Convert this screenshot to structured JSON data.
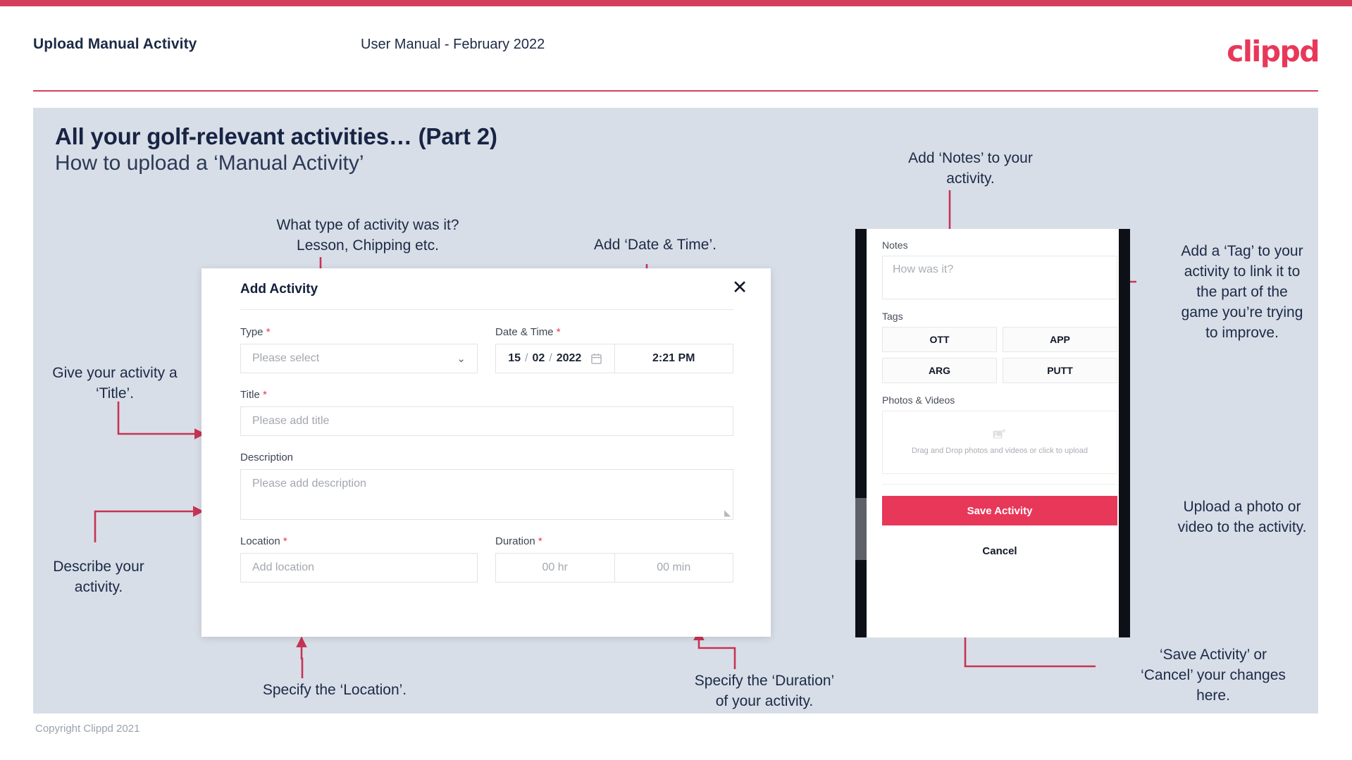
{
  "header": {
    "title": "Upload Manual Activity",
    "subtitle": "User Manual - February 2022",
    "logo": "clippd"
  },
  "slide": {
    "title": "All your golf-relevant activities… (Part 2)",
    "subtitle": "How to upload a ‘Manual Activity’",
    "copyright": "Copyright Clippd 2021"
  },
  "annotations": {
    "type": "What type of activity was it?\nLesson, Chipping etc.",
    "datetime": "Add ‘Date & Time’.",
    "title": "Give your activity a\n‘Title’.",
    "description": "Describe your\nactivity.",
    "location": "Specify the ‘Location’.",
    "duration": "Specify the ‘Duration’\nof your activity.",
    "notes": "Add ‘Notes’ to your\nactivity.",
    "tags": "Add a ‘Tag’ to your\nactivity to link it to\nthe part of the\ngame you’re trying\nto improve.",
    "upload": "Upload a photo or\nvideo to the activity.",
    "save": "‘Save Activity’ or\n‘Cancel’ your changes\nhere."
  },
  "modal": {
    "title": "Add Activity",
    "close_icon": "close-icon",
    "fields": {
      "type": {
        "label": "Type",
        "required": "*",
        "placeholder": "Please select",
        "chevron_icon": "chevron-down-icon"
      },
      "datetime": {
        "label": "Date & Time",
        "required": "*",
        "day": "15",
        "month": "02",
        "year": "2022",
        "sep": "/",
        "calendar_icon": "calendar-icon",
        "time": "2:21 PM"
      },
      "title": {
        "label": "Title",
        "required": "*",
        "placeholder": "Please add title"
      },
      "description": {
        "label": "Description",
        "required": "",
        "placeholder": "Please add description"
      },
      "location": {
        "label": "Location",
        "required": "*",
        "placeholder": "Add location"
      },
      "duration": {
        "label": "Duration",
        "required": "*",
        "hours_placeholder": "00 hr",
        "minutes_placeholder": "00 min"
      }
    }
  },
  "phone": {
    "notes": {
      "label": "Notes",
      "placeholder": "How was it?"
    },
    "tags": {
      "label": "Tags",
      "options": [
        "OTT",
        "APP",
        "ARG",
        "PUTT"
      ]
    },
    "photos": {
      "label": "Photos & Videos",
      "dropzone_icon": "add-image-icon",
      "dropzone_text": "Drag and Drop photos and videos or click to upload"
    },
    "save_label": "Save Activity",
    "cancel_label": "Cancel"
  },
  "colors": {
    "brand": "#e8385a",
    "rule": "#d4405c",
    "slide_bg": "#d8dee7",
    "ink": "#1c2a47",
    "required": "#f0324b"
  }
}
